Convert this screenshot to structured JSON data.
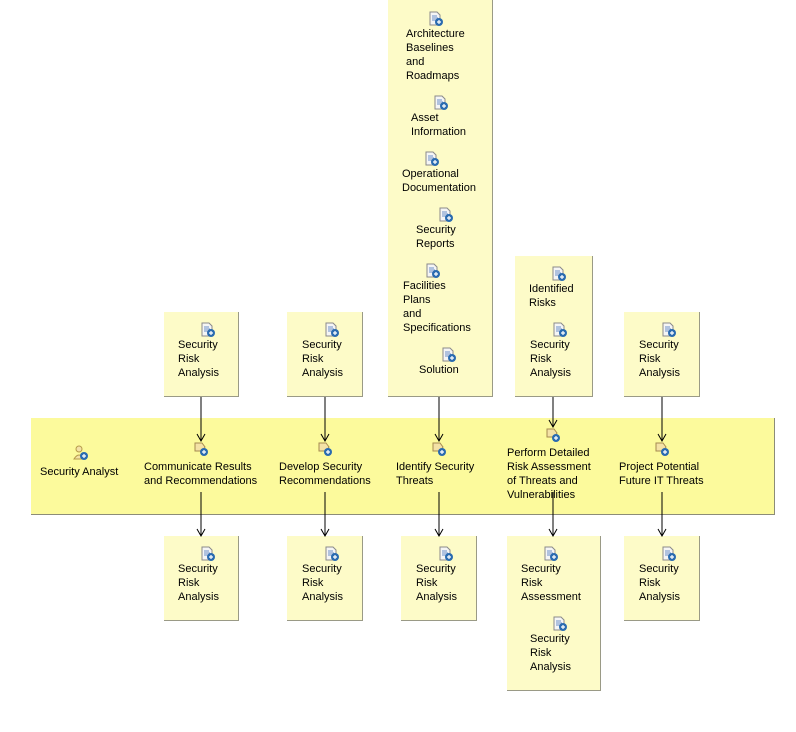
{
  "lane": {
    "role_label": "Security Analyst",
    "role_icon": "role-icon"
  },
  "tasks": [
    {
      "label": "Communicate Results\nand Recommendations",
      "icon": "task-icon"
    },
    {
      "label": "Develop Security\nRecommendations",
      "icon": "task-icon"
    },
    {
      "label": "Identify Security\nThreats",
      "icon": "task-icon"
    },
    {
      "label": "Perform Detailed\nRisk Assessment\nof Threats and\nVulnerabilities",
      "icon": "task-icon"
    },
    {
      "label": "Project Potential\nFuture IT Threats",
      "icon": "task-icon"
    }
  ],
  "inputs": [
    {
      "items": [
        "Security\nRisk\nAnalysis"
      ]
    },
    {
      "items": [
        "Security\nRisk\nAnalysis"
      ]
    },
    {
      "items": [
        "Architecture\nBaselines\nand\nRoadmaps",
        "Asset\nInformation",
        "Operational\nDocumentation",
        "Security\nReports",
        "Facilities\nPlans\nand\nSpecifications",
        "Solution"
      ]
    },
    {
      "items": [
        "Identified\nRisks",
        "Security\nRisk\nAnalysis"
      ]
    },
    {
      "items": [
        "Security\nRisk\nAnalysis"
      ]
    }
  ],
  "outputs": [
    {
      "items": [
        "Security\nRisk\nAnalysis"
      ]
    },
    {
      "items": [
        "Security\nRisk\nAnalysis"
      ]
    },
    {
      "items": [
        "Security\nRisk\nAnalysis"
      ]
    },
    {
      "items": [
        "Security\nRisk\nAssessment",
        "Security\nRisk\nAnalysis"
      ]
    },
    {
      "items": [
        "Security\nRisk\nAnalysis"
      ]
    }
  ],
  "artifact_icon": "work-product-icon",
  "colors": {
    "lane_fill": "#fcfa9c",
    "box_fill": "#fdfbc8",
    "edge": "#000000"
  }
}
